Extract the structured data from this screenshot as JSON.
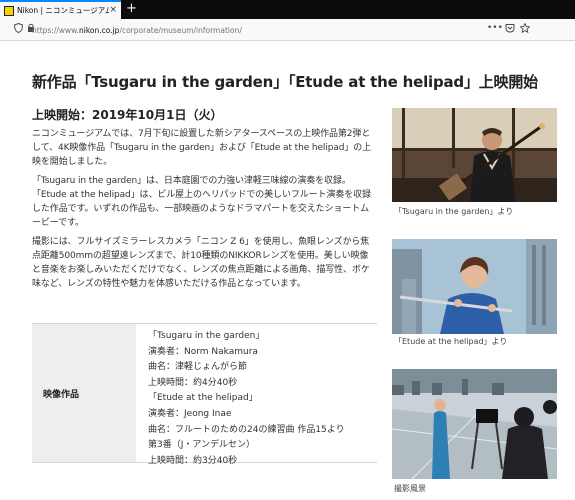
{
  "browser": {
    "tab_title": "Nikon | ニコンミュージアム | ニ",
    "tab_close": "×",
    "new_tab": "+",
    "url_prefix": "https://www.",
    "url_domain": "nikon.co.jp",
    "url_path": "/corporate/museum/information/",
    "menu_dots": "•••"
  },
  "page": {
    "title": "新作品「Tsugaru in the garden」「Etude at the helipad」上映開始",
    "release_date": "上映開始：2019年10月1日（火）",
    "paragraphs": [
      "ニコンミュージアムでは、7月下旬に設置した新シアタースペースの上映作品第2弾として、4K映像作品「Tsugaru in the garden」および「Etude at the helipad」の上映を開始しました。",
      "「Tsugaru in the garden」は、日本庭園での力強い津軽三味線の演奏を収録。「Etude at the helipad」は、ビル屋上のヘリパッドでの美しいフルート演奏を収録した作品です。いずれの作品も、一部映画のようなドラマパートを交えたショートムービーです。",
      "撮影には、フルサイズミラーレスカメラ「ニコン Z 6」を使用し、魚眼レンズから焦点距離500mmの超望遠レンズまで、計10種類のNIKKORレンズを使用。美しい映像と音楽をお楽しみいただくだけでなく、レンズの焦点距離による画角、描写性、ボケ味など、レンズの特性や魅力を体感いただける作品となっています。"
    ],
    "credits": {
      "heading": "映像作品",
      "lines": [
        "「Tsugaru in the garden」",
        "演奏者：Norm Nakamura",
        "曲名：津軽じょんがら節",
        "上映時間：約4分40秒",
        "「Etude at the helipad」",
        "演奏者：Jeong Inae",
        "曲名：フルートのための24の練習曲 作品15より",
        "第3番（J・アンデルセン）",
        "上映時間：約3分40秒"
      ]
    },
    "photos": [
      {
        "caption": "「Tsugaru in the garden」より",
        "icon": "shamisen-player-photo"
      },
      {
        "caption": "「Etude at the helipad」より",
        "icon": "flute-player-photo"
      },
      {
        "caption": "撮影風景",
        "icon": "filming-scene-photo"
      }
    ]
  },
  "colors": {
    "tabbar": "#0c0c0d",
    "accent": "#0a84ff",
    "table_head_bg": "#eeeeee"
  }
}
